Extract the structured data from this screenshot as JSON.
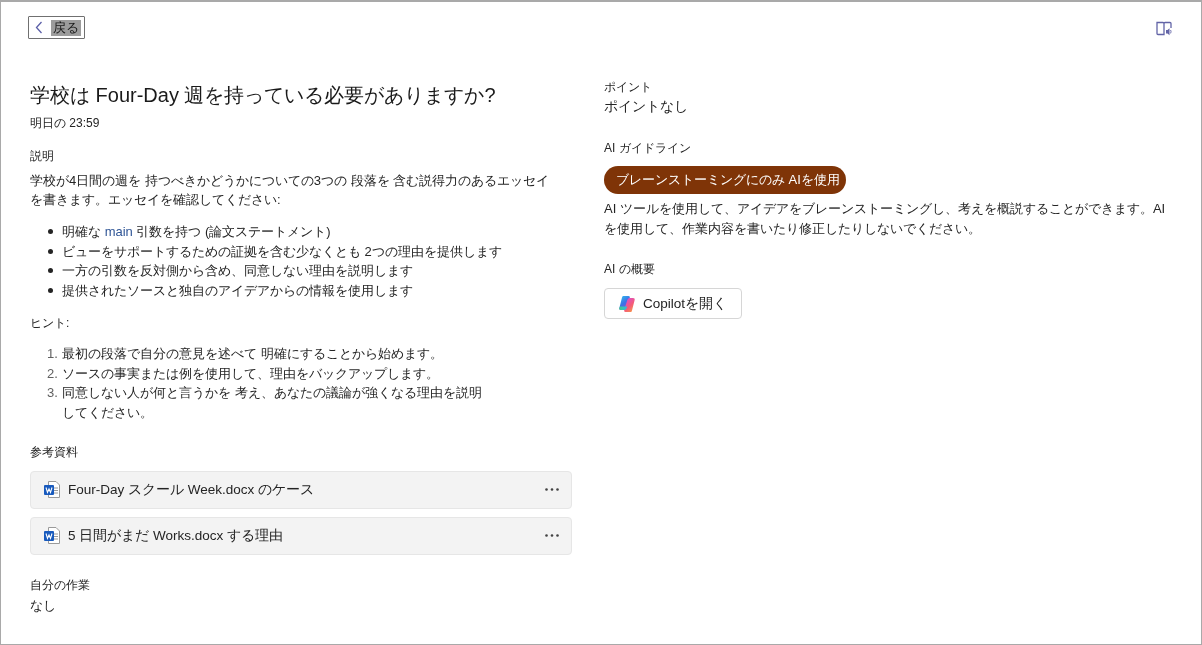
{
  "back_button": {
    "label": "戻る"
  },
  "assignment": {
    "title": "学校は Four-Day 週を持っている必要がありますか?",
    "due": "明日の 23:59"
  },
  "instructions": {
    "heading": "説明",
    "text": "学校が4日間の週を 持つべきかどうかについての3つの 段落を 含む説得力のあるエッセイを書きます。エッセイを確認してください:",
    "bullets": [
      {
        "segments": [
          {
            "text": "明確な ",
            "highlight": false
          },
          {
            "text": "main",
            "highlight": true
          },
          {
            "text": " 引数を持つ (論文ステートメント)",
            "highlight": false
          }
        ]
      },
      {
        "segments": [
          {
            "text": "ビューをサポートするための証拠を含む少なくとも 2つの理由を提供します",
            "highlight": false
          }
        ]
      },
      {
        "segments": [
          {
            "text": "一方の引数を反対側から含め、同意しない理由を説明します",
            "highlight": false
          }
        ]
      },
      {
        "segments": [
          {
            "text": "提供されたソースと独自のアイデアからの情報を使用します",
            "highlight": false
          }
        ]
      }
    ],
    "hints_heading": "ヒント:",
    "hints": [
      {
        "number": "1.",
        "text": "最初の段落で自分の意見を述べて 明確にすることから始めます。"
      },
      {
        "number": "2.",
        "text": "ソースの事実または例を使用して、理由をバックアップします。"
      },
      {
        "number": "3.",
        "text": "同意しない人が何と言うかを 考え、あなたの議論が強くなる理由を説明してください。"
      }
    ]
  },
  "reference_materials": {
    "heading": "参考資料",
    "files": [
      {
        "name": "Four-Day スクール Week.docx のケース"
      },
      {
        "name": "5 日間がまだ Works.docx する理由"
      }
    ]
  },
  "my_work": {
    "heading": "自分の作業",
    "value": "なし"
  },
  "points": {
    "heading": "ポイント",
    "value": "ポイントなし"
  },
  "ai_guidelines": {
    "heading": "AI ガイドライン",
    "tag": "ブレーンストーミングにのみ AIを使用",
    "text": "AI ツールを使用して、アイデアをブレーンストーミングし、考えを概説することができます。AIを使用して、作業内容を書いたり修正したりしないでください。"
  },
  "ai_overview": {
    "heading": "AI の概要",
    "button": "Copilotを開く"
  }
}
